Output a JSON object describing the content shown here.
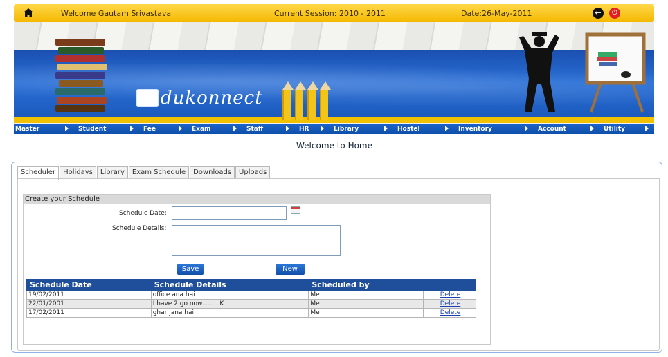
{
  "topbar": {
    "welcome": "Welcome Gautam Srivastava",
    "session": "Current Session: 2010 - 2011",
    "date": "Date:26-May-2011"
  },
  "banner": {
    "logo_text": "dukonnect"
  },
  "menu": [
    "Master",
    "Student",
    "Fee",
    "Exam",
    "Staff",
    "HR",
    "Library",
    "Hostel",
    "Inventory",
    "Account",
    "Utility"
  ],
  "page_title": "Welcome to Home",
  "tabs": [
    "Scheduler",
    "Holidays",
    "Library",
    "Exam Schedule",
    "Downloads",
    "Uploads"
  ],
  "scheduler": {
    "section_title": "Create your Schedule",
    "date_label": "Schedule Date:",
    "details_label": "Schedule Details:",
    "date_value": "",
    "details_value": "",
    "save_label": "Save",
    "new_label": "New"
  },
  "table": {
    "headers": [
      "Schedule Date",
      "Schedule Details",
      "Scheduled by",
      ""
    ],
    "rows": [
      {
        "date": "19/02/2011",
        "details": "office ana hai",
        "by": "Me",
        "action": "Delete"
      },
      {
        "date": "22/01/2001",
        "details": "I have 2 go now.........K",
        "by": "Me",
        "action": "Delete"
      },
      {
        "date": "17/02/2011",
        "details": "ghar jana hai",
        "by": "Me",
        "action": "Delete"
      }
    ]
  },
  "colors": {
    "accent_yellow": "#f4b800",
    "menu_blue": "#0f4fa9",
    "table_header": "#1f4e9a",
    "button_blue": "#124fa8"
  }
}
